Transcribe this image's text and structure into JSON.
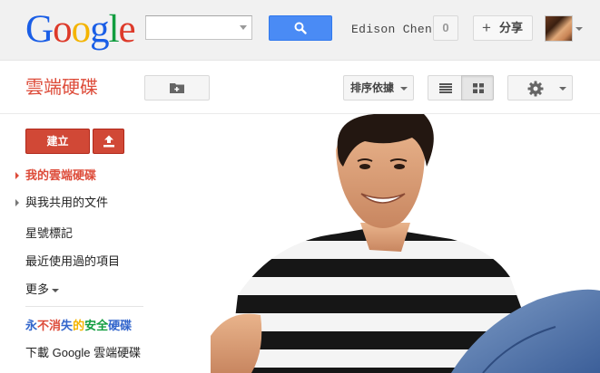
{
  "topbar": {
    "logo": {
      "letters": [
        {
          "ch": "G",
          "color": "#1a5ee6"
        },
        {
          "ch": "o",
          "color": "#dd3a2a"
        },
        {
          "ch": "o",
          "color": "#f4b400"
        },
        {
          "ch": "g",
          "color": "#1a5ee6"
        },
        {
          "ch": "l",
          "color": "#119d3f"
        },
        {
          "ch": "e",
          "color": "#dd3a2a"
        }
      ]
    },
    "search": {
      "value": "",
      "placeholder": ""
    },
    "user_name": "Edison Chen",
    "notification_count": "0",
    "share_icon": "+",
    "share_label": "分享",
    "colors": {
      "search_button": "#4a8bf5"
    }
  },
  "toolbar": {
    "app_title": "雲端硬碟",
    "new_folder_icon": "folder-plus-icon",
    "sort_label": "排序依據",
    "views": [
      "list-view-icon",
      "grid-view-icon"
    ],
    "active_view": "grid",
    "settings_icon": "gear-icon"
  },
  "sidebar": {
    "create_label": "建立",
    "upload_icon": "upload-icon",
    "nav": {
      "my_drive": "我的雲端硬碟",
      "shared": "與我共用的文件",
      "starred": "星號標記",
      "recent": "最近使用過的項目",
      "more": "更多"
    },
    "promo": {
      "segments": [
        {
          "text": "永",
          "color": "#3366cc"
        },
        {
          "text": "不",
          "color": "#dd4b39"
        },
        {
          "text": "消",
          "color": "#dd4b39"
        },
        {
          "text": "失",
          "color": "#3366cc"
        },
        {
          "text": "的",
          "color": "#f4b400"
        },
        {
          "text": "安",
          "color": "#119d3f"
        },
        {
          "text": "全",
          "color": "#119d3f"
        },
        {
          "text": "硬",
          "color": "#3366cc"
        },
        {
          "text": "碟",
          "color": "#3366cc"
        }
      ]
    },
    "download_label": "下載 Google 雲端硬碟",
    "colors": {
      "accent": "#dd4b39",
      "create_button": "#d14836"
    }
  }
}
